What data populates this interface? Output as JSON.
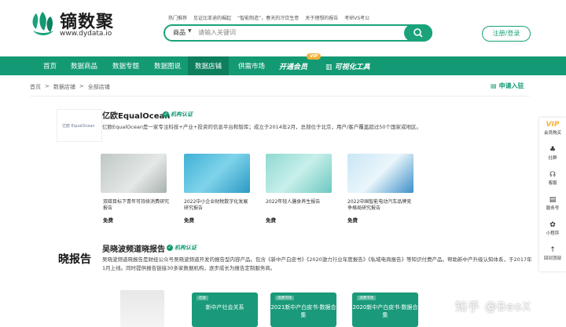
{
  "header": {
    "brand_cn": "镝数聚",
    "domain": "www.dydata.io",
    "hot_searches": [
      "热门推荐",
      "见证比亚迪的崛起",
      "“智能制造”，春天的冷饮生意",
      "关于理想的报告",
      "考研VS考公"
    ],
    "search": {
      "category": "商品",
      "placeholder": "请输入关键词"
    },
    "login_label": "注册/登录"
  },
  "nav": {
    "items": [
      "首页",
      "数据商品",
      "数据专题",
      "数据图说",
      "数据店铺",
      "供需市场",
      "开通会员",
      "可视化工具"
    ],
    "vip_tag": "VIP",
    "active_index": 4
  },
  "breadcrumb": [
    "首页",
    ">",
    "数据店铺",
    ">",
    "全部店铺"
  ],
  "apply_label": "申请入驻",
  "shops": [
    {
      "name": "亿欧EqualOcean",
      "logo_text": "亿欧 EqualOcean",
      "badge": "机构认证",
      "desc": "亿欧EqualOcean是一家专注科技+产业+投资的信息平台和智库；成立于2014年2月，总部位于北京，用户/客户覆盖超过50个国家或地区。",
      "reports": [
        {
          "title": "双碳目标下青年可持续消费研究报告",
          "price": "免费"
        },
        {
          "title": "2022中小企业财税数字化发展研究报告",
          "price": "免费"
        },
        {
          "title": "2022年轻人膳食养生报告",
          "price": "免费"
        },
        {
          "title": "2022中国智能电动汽车品牌竞争格局研究报告",
          "price": "免费"
        }
      ]
    },
    {
      "name": "吴晓波频道晓报告",
      "logo_text": "晓报告",
      "badge": "机构认证",
      "desc": "吴晓波频道晓报告是财经公众号吴晓波频道开发的报告型内容产品。包含《新中产白皮书》《2020激力行业年度报告》《私域电商报告》等知识付费产品。帮助新中产升级认知体系，于2017年1月上线。同时提供报告链接30多家数据机构，逐步成长为报告定制服务商。",
      "reports": [
        {
          "tag": "",
          "title": ""
        },
        {
          "tag": "社会",
          "title": "新中产社会关系"
        },
        {
          "tag": "消费市场",
          "title": "2021新中产白皮书·数据合集"
        },
        {
          "tag": "消费市场",
          "title": "2020新中产白皮书·数据合集"
        }
      ]
    }
  ],
  "sidebar": [
    {
      "icon": "vip-icon",
      "label": "会员购买"
    },
    {
      "icon": "community-icon",
      "label": "社群"
    },
    {
      "icon": "headset-icon",
      "label": "客服"
    },
    {
      "icon": "document-icon",
      "label": "服务号"
    },
    {
      "icon": "miniprogram-icon",
      "label": "小程序"
    },
    {
      "icon": "arrow-up-icon",
      "label": "回到顶部"
    }
  ],
  "watermark": "知乎 @BeoX",
  "colors": {
    "accent": "#139a74",
    "vip": "#f4b13a"
  }
}
